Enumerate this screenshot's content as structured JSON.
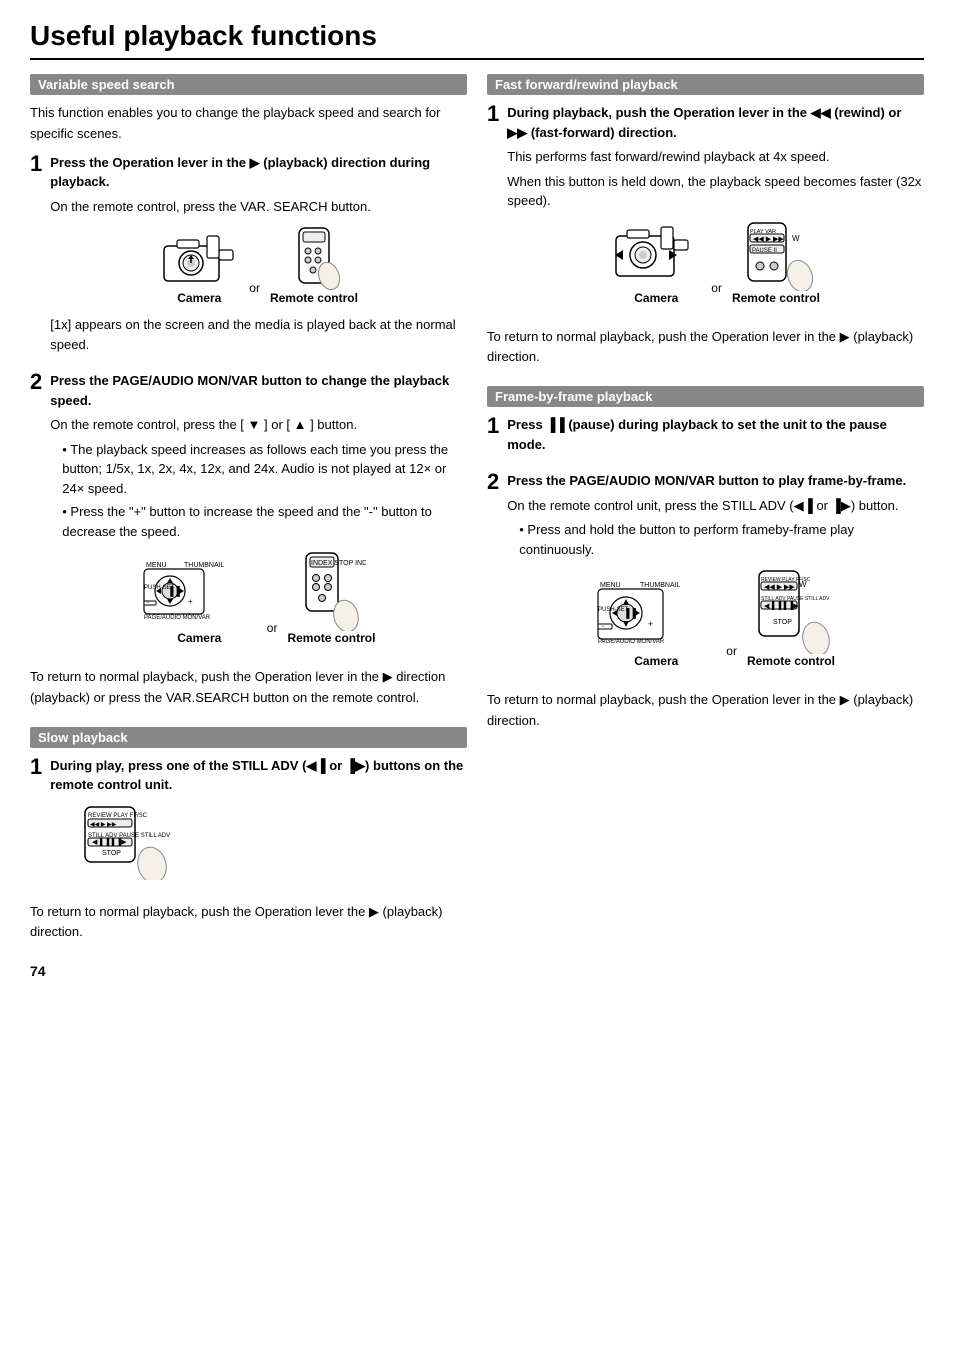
{
  "page": {
    "title": "Useful playback functions",
    "page_number": "74"
  },
  "left_column": {
    "section1": {
      "header": "Variable speed search",
      "intro": "This function enables you to change the playback speed and search for specific scenes.",
      "steps": [
        {
          "num": "1",
          "title": "Press the Operation lever in the ▶ (playback) direction during playback.",
          "detail1": "On the remote control, press the VAR. SEARCH button.",
          "img_label_left": "Camera",
          "img_or": "or",
          "img_label_right": "Remote control",
          "detail2": "[1x] appears on the screen and the media is played back at the normal speed."
        },
        {
          "num": "2",
          "title": "Press the PAGE/AUDIO MON/VAR button to change the playback speed.",
          "detail1": "On the remote control, press the [ ▼ ] or [ ▲ ] button.",
          "bullets": [
            "The playback speed increases as follows each time you press the button; 1/5x, 1x, 2x, 4x, 12x, and 24x. Audio is not played at 12× or 24× speed.",
            "Press the \"+\" button to increase the speed and the \"-\" button to decrease the speed."
          ],
          "img_label_left": "Camera",
          "img_or": "or",
          "img_label_right": "Remote control"
        }
      ],
      "footer": "To return to normal playback, push the Operation lever in the ▶ direction (playback) or press the VAR.SEARCH button on the remote control."
    },
    "section2": {
      "header": "Slow playback",
      "steps": [
        {
          "num": "1",
          "title": "During play, press one of the STILL ADV (◀▐ or ▐▶) buttons on the remote control unit."
        }
      ],
      "footer": "To return to normal playback, push the Operation lever the ▶ (playback) direction."
    }
  },
  "right_column": {
    "section1": {
      "header": "Fast forward/rewind playback",
      "steps": [
        {
          "num": "1",
          "title": "During playback, push the Operation lever in the ◀◀ (rewind) or ▶▶ (fast-forward) direction.",
          "detail1": "This performs fast forward/rewind playback at 4x speed.",
          "detail2": "When this button is held down, the playback speed becomes faster (32x speed).",
          "img_label_left": "Camera",
          "img_or": "or",
          "img_label_right": "Remote control"
        }
      ],
      "footer": "To return to normal playback, push the Operation lever in the ▶ (playback) direction."
    },
    "section2": {
      "header": "Frame-by-frame playback",
      "steps": [
        {
          "num": "1",
          "title": "Press ▐▐ (pause) during playback to set the unit to the pause mode."
        },
        {
          "num": "2",
          "title": "Press the PAGE/AUDIO MON/VAR button to play frame-by-frame.",
          "detail1": "On the remote control unit, press the STILL ADV (◀▐ or ▐▶) button.",
          "bullets": [
            "Press and hold the button to perform frameby-frame play continuously."
          ],
          "img_label_left": "Camera",
          "img_or": "or",
          "img_label_right": "Remote control"
        }
      ],
      "footer": "To return to normal playback, push the Operation lever in the ▶ (playback) direction."
    }
  }
}
